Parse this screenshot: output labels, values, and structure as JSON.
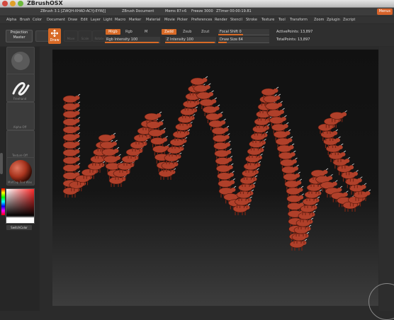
{
  "window": {
    "title": "ZBrushOSX"
  },
  "infobar": {
    "items": [
      "ZBrush 3.1 [ZWQH-XHAD-ACYJ-EYWJ]",
      "ZBrush Document",
      "Mems 87+6",
      "Freeze 3000",
      "ZTimer 00:00:19.81"
    ],
    "menus_label": "Menus"
  },
  "menubar": {
    "items": [
      "Alpha",
      "Brush",
      "Color",
      "Document",
      "Draw",
      "Edit",
      "Layer",
      "Light",
      "Macro",
      "Marker",
      "Material",
      "Movie",
      "Picker",
      "Preferences",
      "Render",
      "Stencil",
      "Stroke",
      "Texture",
      "Tool",
      "Transform",
      "Zoom",
      "Zplugin",
      "Zscript"
    ]
  },
  "toolbar": {
    "projection_master_line1": "Projection",
    "projection_master_line2": "Master",
    "draw_label": "Draw",
    "move_label": "Move",
    "scale_label": "Scale",
    "rotate_label": "Rotate",
    "mrgb": "Mrgb",
    "rgb": "Rgb",
    "m": "M",
    "zadd": "Zadd",
    "zsub": "Zsub",
    "zcut": "Zcut",
    "rgb_intensity": "Rgb Intensity 100",
    "z_intensity": "Z Intensity 100",
    "focal_shift": "Focal Shift 0",
    "draw_size": "Draw Size 64",
    "active_points": "ActivePoints: 13,897",
    "total_points": "TotalPoints: 13,897"
  },
  "sidebar": {
    "labels": [
      "Freehand",
      "Alpha Off",
      "Texture Off",
      "MatCap Red Wax"
    ],
    "switch_color": "SwitchColor"
  },
  "colors": {
    "accent": "#d86a26",
    "model": "#b0402a"
  }
}
